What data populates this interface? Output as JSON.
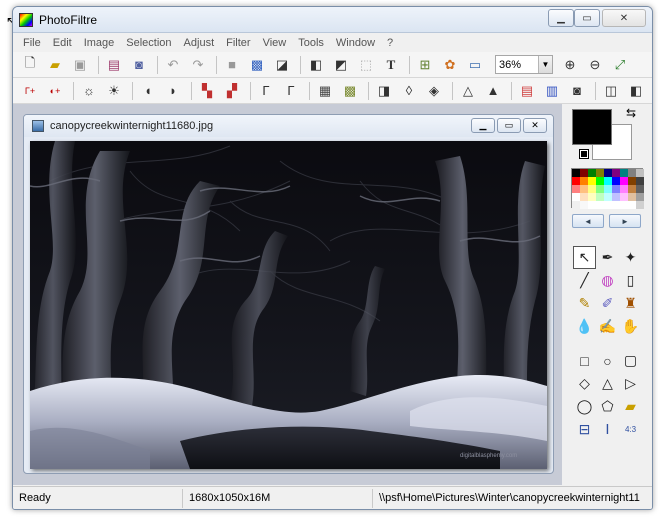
{
  "window": {
    "title": "PhotoFiltre"
  },
  "menu": [
    "File",
    "Edit",
    "Image",
    "Selection",
    "Adjust",
    "Filter",
    "View",
    "Tools",
    "Window",
    "?"
  ],
  "toolbar": {
    "zoom_value": "36%"
  },
  "document": {
    "title": "canopycreekwinternight11680.jpg",
    "watermark": "digitalblasphemy.com"
  },
  "status": {
    "state": "Ready",
    "dimensions": "1680x1050x16M",
    "path": "\\\\psf\\Home\\Pictures\\Winter\\canopycreekwinternight11"
  },
  "colors": {
    "foreground": "#000000",
    "background": "#ffffff",
    "palette": [
      "#000000",
      "#800000",
      "#008000",
      "#808000",
      "#000080",
      "#800080",
      "#008080",
      "#808080",
      "#c0c0c0",
      "#ff0000",
      "#ff8000",
      "#ffff00",
      "#00ff00",
      "#00ffff",
      "#0000ff",
      "#ff00ff",
      "#804000",
      "#404040",
      "#ff8080",
      "#ffc080",
      "#ffff80",
      "#80ff80",
      "#80ffff",
      "#8080ff",
      "#ff80ff",
      "#c08040",
      "#606060",
      "#ffffff",
      "#ffe0c0",
      "#ffffc0",
      "#c0ffc0",
      "#c0ffff",
      "#c0c0ff",
      "#ffc0ff",
      "#e0c0a0",
      "#a0a0a0",
      "#f0f0f0",
      "#f8f8f8",
      "#ffffff",
      "#ffffff",
      "#ffffff",
      "#ffffff",
      "#ffffff",
      "#ffffff",
      "#d0d0d0"
    ]
  }
}
